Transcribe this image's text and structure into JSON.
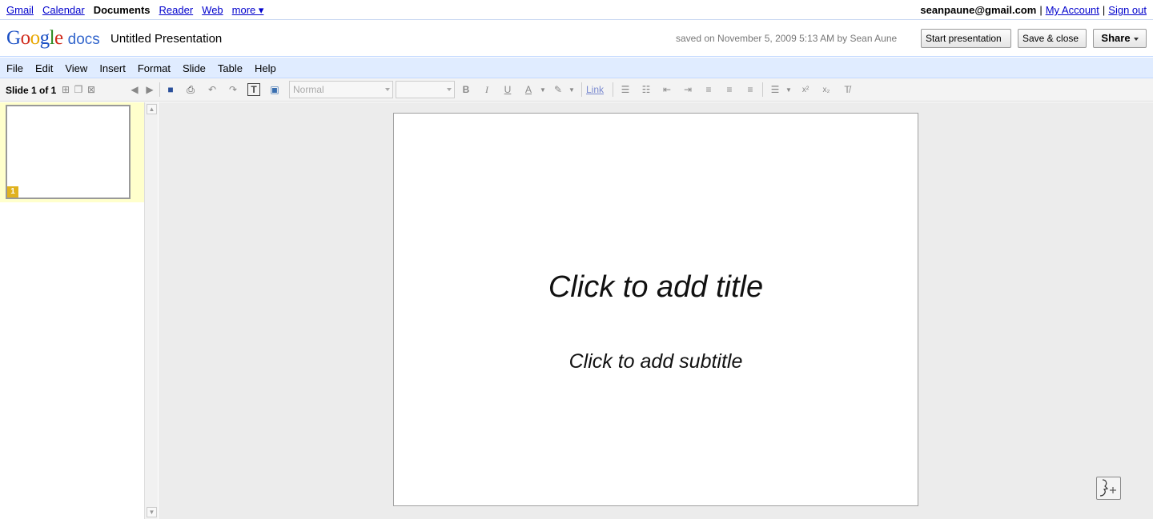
{
  "gbar": {
    "links": [
      "Gmail",
      "Calendar"
    ],
    "current": "Documents",
    "links2": [
      "Reader",
      "Web"
    ],
    "more": "more ▾",
    "email": "seanpaune@gmail.com",
    "sep": "|",
    "my_account": "My Account",
    "sign_out": "Sign out"
  },
  "header": {
    "logo_google": [
      "G",
      "o",
      "o",
      "g",
      "l",
      "e"
    ],
    "logo_docs": "docs",
    "doc_title": "Untitled Presentation",
    "saved_status": "saved on November 5, 2009 5:13 AM by Sean Aune",
    "start_presentation": "Start presentation",
    "save_close": "Save & close",
    "share": "Share"
  },
  "menubar": [
    "File",
    "Edit",
    "View",
    "Insert",
    "Format",
    "Slide",
    "Table",
    "Help"
  ],
  "toolbar": {
    "slide_count": "Slide 1 of 1",
    "style_select": "Normal",
    "font_size_select": "",
    "link": "Link",
    "bold": "B",
    "italic": "I",
    "underline": "U",
    "text_color": "A"
  },
  "slides": [
    {
      "number": "1"
    }
  ],
  "slide": {
    "title_placeholder": "Click to add title",
    "subtitle_placeholder": "Click to add subtitle"
  },
  "colors": {
    "menubar_bg": "#e0ecff",
    "thumb_panel_bg": "#ffffcc",
    "slide_number_badge": "#e0b21e",
    "canvas_bg": "#ececec"
  }
}
